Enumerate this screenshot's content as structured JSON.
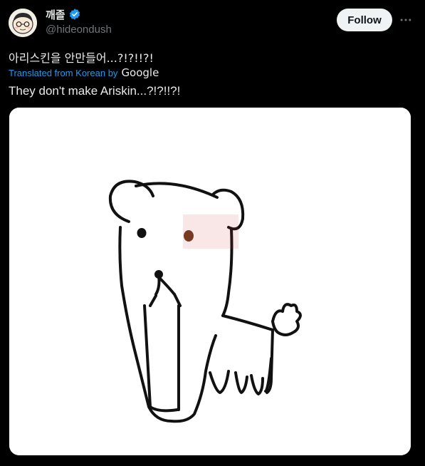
{
  "user": {
    "display_name": "깨졸",
    "handle": "@hideondush",
    "verified": true
  },
  "actions": {
    "follow_label": "Follow",
    "more_icon": "more-horizontal-icon"
  },
  "tweet": {
    "text": "아리스킨을 안만들어...?!?!!?!",
    "translation_label": "Translated from Korean by",
    "translation_provider": "Google",
    "translated_text": "They don't make Ariskin...?!?!!?!"
  },
  "media": {
    "type": "drawing",
    "description_icon": "dog-drawing"
  },
  "colors": {
    "background": "#000000",
    "text": "#e7e9ea",
    "secondary_text": "#71767b",
    "link_blue": "#1d9bf0",
    "follow_button_bg": "#eff3f4"
  }
}
